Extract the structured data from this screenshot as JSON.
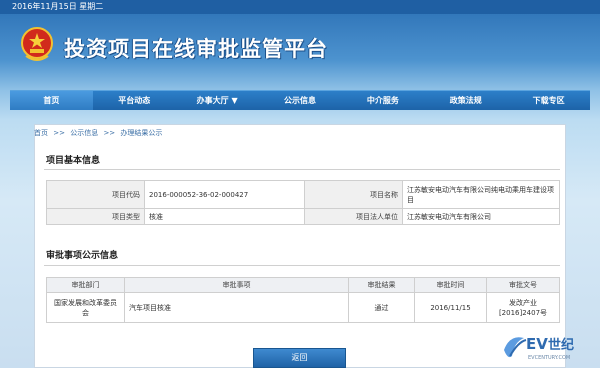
{
  "header": {
    "date": "2016年11月15日 星期二",
    "site_title": "投资项目在线审批监管平台"
  },
  "nav": {
    "items": [
      "首页",
      "平台动态",
      "办事大厅 ▼",
      "公示信息",
      "中介服务",
      "政策法规",
      "下载专区"
    ]
  },
  "breadcrumb": {
    "items": [
      "首页",
      ">>",
      "公示信息",
      ">>",
      "办理结果公示"
    ]
  },
  "basic_info": {
    "title": "项目基本信息",
    "code_label": "项目代码",
    "code_value": "2016-000052-36-02-000427",
    "name_label": "项目名称",
    "name_value": "江苏敏安电动汽车有限公司纯电动乘用车建设项目",
    "type_label": "项目类型",
    "type_value": "核准",
    "legal_label": "项目法人单位",
    "legal_value": "江苏敏安电动汽车有限公司"
  },
  "approval": {
    "title": "审批事项公示信息",
    "headers": [
      "审批部门",
      "审批事项",
      "审批结果",
      "审批时间",
      "审批文号"
    ],
    "row": {
      "dept": "国家发展和改革委员会",
      "item": "汽车项目核准",
      "result": "通过",
      "time": "2016/11/15",
      "doc_line1": "发改产业",
      "doc_line2": "[2016]2407号"
    }
  },
  "back_button": "返回",
  "watermark": {
    "ev": "EV",
    "cn": "世纪",
    "sub": "EVCENTURY.COM"
  }
}
